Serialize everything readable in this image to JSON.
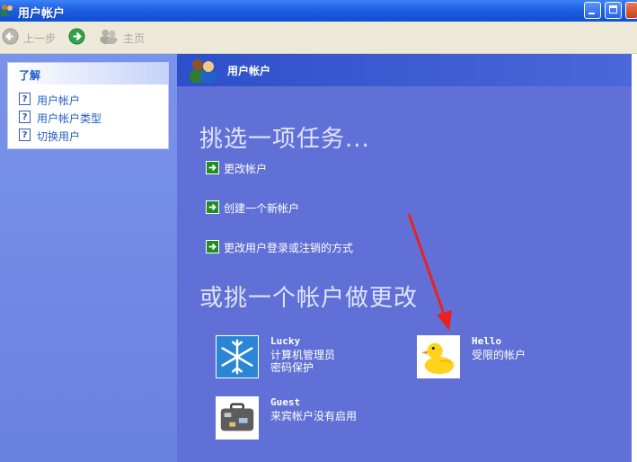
{
  "window": {
    "title": "用户帐户"
  },
  "toolbar": {
    "back_label": "上一步",
    "home_label": "主页"
  },
  "sidebar": {
    "panel_title": "了解",
    "items": [
      {
        "label": "用户帐户"
      },
      {
        "label": "用户帐户类型"
      },
      {
        "label": "切换用户"
      }
    ]
  },
  "main": {
    "header_title": "用户帐户",
    "pick_task_heading": "挑选一项任务...",
    "tasks": [
      {
        "label": "更改帐户"
      },
      {
        "label": "创建一个新帐户"
      },
      {
        "label": "更改用户登录或注销的方式"
      }
    ],
    "pick_account_heading": "或挑一个帐户做更改",
    "accounts": [
      {
        "name": "Lucky",
        "line1": "计算机管理员",
        "line2": "密码保护",
        "icon": "snowflake-icon"
      },
      {
        "name": "Hello",
        "line1": "受限的帐户",
        "line2": "",
        "icon": "duck-icon"
      },
      {
        "name": "Guest",
        "line1": "来宾帐户没有启用",
        "line2": "",
        "icon": "suitcase-icon"
      }
    ]
  },
  "colors": {
    "title_bar": "#1f5fe0",
    "main_bg": "#6070d6",
    "annotation_arrow": "#e8231f"
  }
}
